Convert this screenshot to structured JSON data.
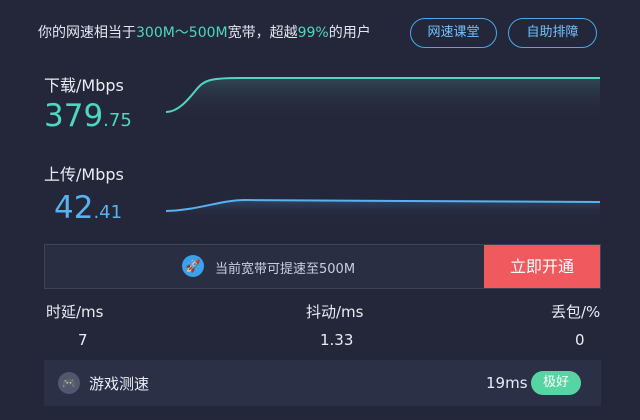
{
  "header": {
    "prefix": "你的网速相当于",
    "range": "300M～500M",
    "middle": "宽带，超越",
    "percent": "99%",
    "suffix": "的用户",
    "btn_course": "网速课堂",
    "btn_help": "自助排障"
  },
  "download": {
    "label": "下载/Mbps",
    "int": "379",
    "dec": ".75",
    "color": "#4fd6c2"
  },
  "upload": {
    "label": "上传/Mbps",
    "int": "42",
    "dec": ".41",
    "color": "#59b2f0"
  },
  "boost": {
    "rocket_icon": "rocket-icon",
    "text": "当前宽带可提速至500M",
    "button": "立即开通",
    "button_color": "#f05a5f"
  },
  "stats": {
    "latency_label": "时延/ms",
    "latency_value": "7",
    "jitter_label": "抖动/ms",
    "jitter_value": "1.33",
    "loss_label": "丢包/%",
    "loss_value": "0"
  },
  "game": {
    "icon": "gamepad-icon",
    "label": "游戏测速",
    "ms": "19ms",
    "badge": "极好",
    "badge_color": "#56d4a3"
  }
}
